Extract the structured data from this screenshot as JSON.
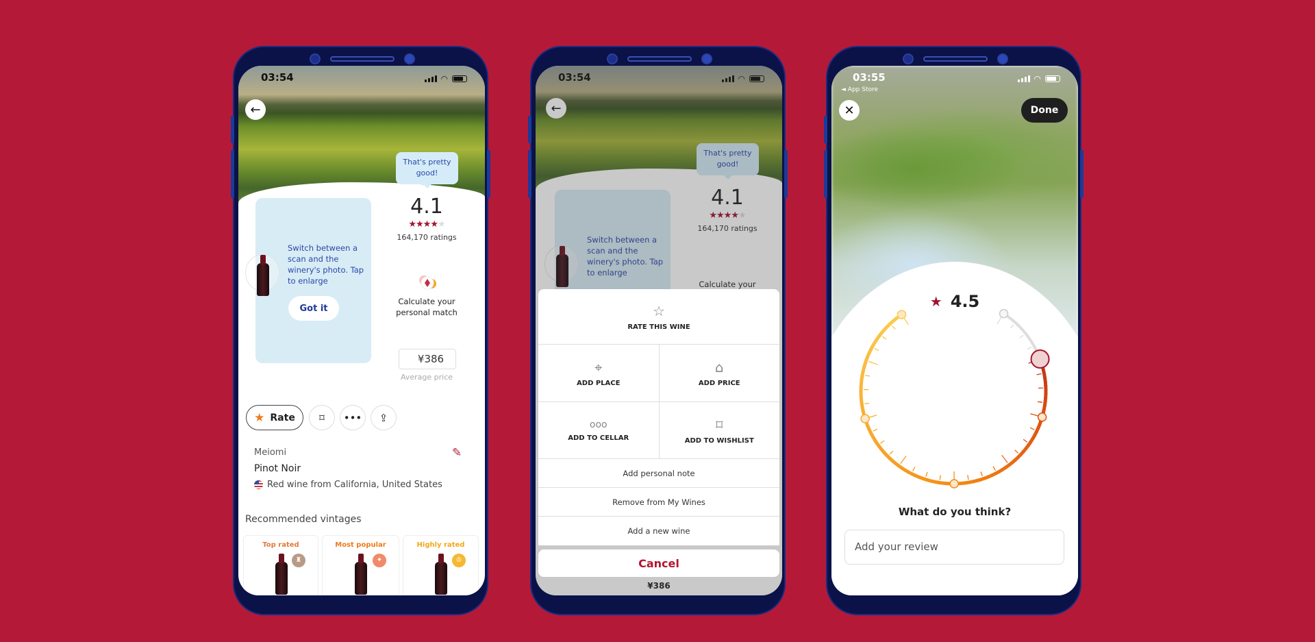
{
  "colors": {
    "background": "#b41a38",
    "frame": "#0a1248",
    "accent": "#a3142e",
    "tip_blue": "#2a48a8"
  },
  "phone1": {
    "time": "03:54",
    "tooltip": "That's pretty good!",
    "rating": "4.1",
    "stars_filled": 4,
    "stars_total": 5,
    "ratings_count": "164,170 ratings",
    "tip_text": "Switch between a scan and the winery's photo. Tap to enlarge",
    "got_it": "Got it",
    "match_text": "Calculate your personal match",
    "price": "¥386",
    "price_label": "Average price",
    "rate_label": "Rate",
    "winery": "Meiomi",
    "wine": "Pinot Noir",
    "origin": "Red wine from California, United States",
    "recommended_title": "Recommended vintages",
    "vintages": [
      {
        "label": "Top rated",
        "color": "#e07a3a",
        "badge": "#b99a86"
      },
      {
        "label": "Most popular",
        "color": "#f07a1a",
        "badge": "#f08a6a"
      },
      {
        "label": "Highly rated",
        "color": "#f0a818",
        "badge": "#f5b830"
      }
    ]
  },
  "phone2": {
    "time": "03:54",
    "tooltip": "That's pretty good!",
    "rating": "4.1",
    "ratings_count": "164,170 ratings",
    "tip_text": "Switch between a scan and the winery's photo. Tap to enlarge",
    "match_text": "Calculate your",
    "behind_price": "¥386",
    "sheet": {
      "rate": "RATE THIS WINE",
      "add_place": "ADD PLACE",
      "add_price": "ADD PRICE",
      "add_cellar": "ADD TO CELLAR",
      "add_wishlist": "ADD TO WISHLIST",
      "note": "Add personal note",
      "remove": "Remove from My Wines",
      "new_wine": "Add a new wine",
      "cancel": "Cancel"
    }
  },
  "phone3": {
    "time": "03:55",
    "back_app": "◄ App Store",
    "done": "Done",
    "rating": "4.5",
    "rating_min": 1,
    "rating_max": 5,
    "question": "What do you think?",
    "review_placeholder": "Add your review"
  }
}
